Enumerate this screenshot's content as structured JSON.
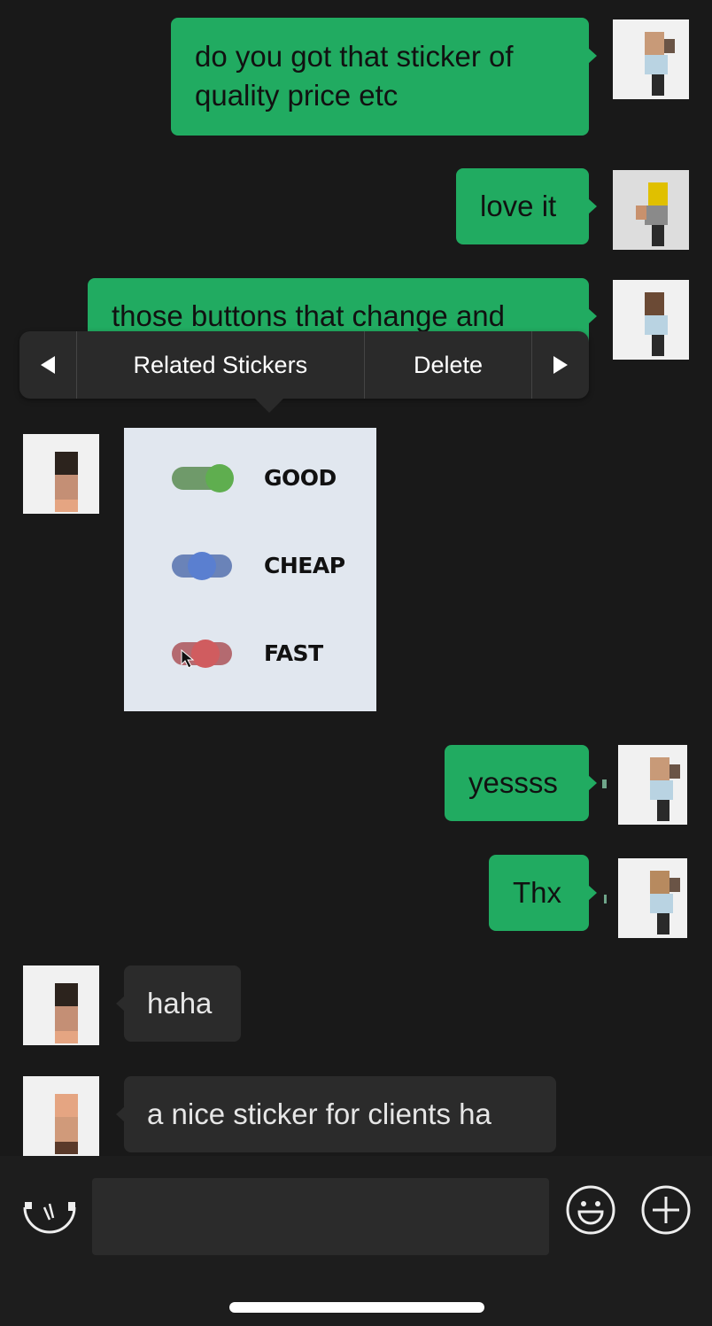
{
  "messages": [
    {
      "direction": "outgoing",
      "text_lines": [
        "do you got that sticker of",
        "quality price etc"
      ]
    },
    {
      "direction": "outgoing",
      "text": "love it"
    },
    {
      "direction": "outgoing",
      "text": "those buttons that change and"
    },
    {
      "direction": "incoming",
      "type": "sticker"
    },
    {
      "direction": "outgoing",
      "text": "yessss"
    },
    {
      "direction": "outgoing",
      "text": "Thx"
    },
    {
      "direction": "incoming",
      "text": "haha"
    },
    {
      "direction": "incoming",
      "text": "a nice sticker for clients ha"
    }
  ],
  "context_menu": {
    "prev_icon": "triangle-left-icon",
    "items": [
      "Related Stickers",
      "Delete"
    ],
    "next_icon": "triangle-right-icon"
  },
  "sticker": {
    "rows": [
      {
        "label": "GOOD",
        "color": "#5fae4f",
        "track_color": "#6f9a6a",
        "state": "on"
      },
      {
        "label": "CHEAP",
        "color": "#5a7fd0",
        "track_color": "#6a83b8",
        "state": "middle"
      },
      {
        "label": "FAST",
        "color": "#d05c5f",
        "track_color": "#b46a70",
        "state": "middle"
      }
    ]
  },
  "input_bar": {
    "voice_icon": "voice-icon",
    "placeholder": "",
    "emoji_icon": "smiley-icon",
    "add_icon": "plus-circle-icon"
  },
  "colors": {
    "background": "#191919",
    "outgoing_bubble": "#21ab61",
    "incoming_bubble": "#2b2b2b"
  }
}
